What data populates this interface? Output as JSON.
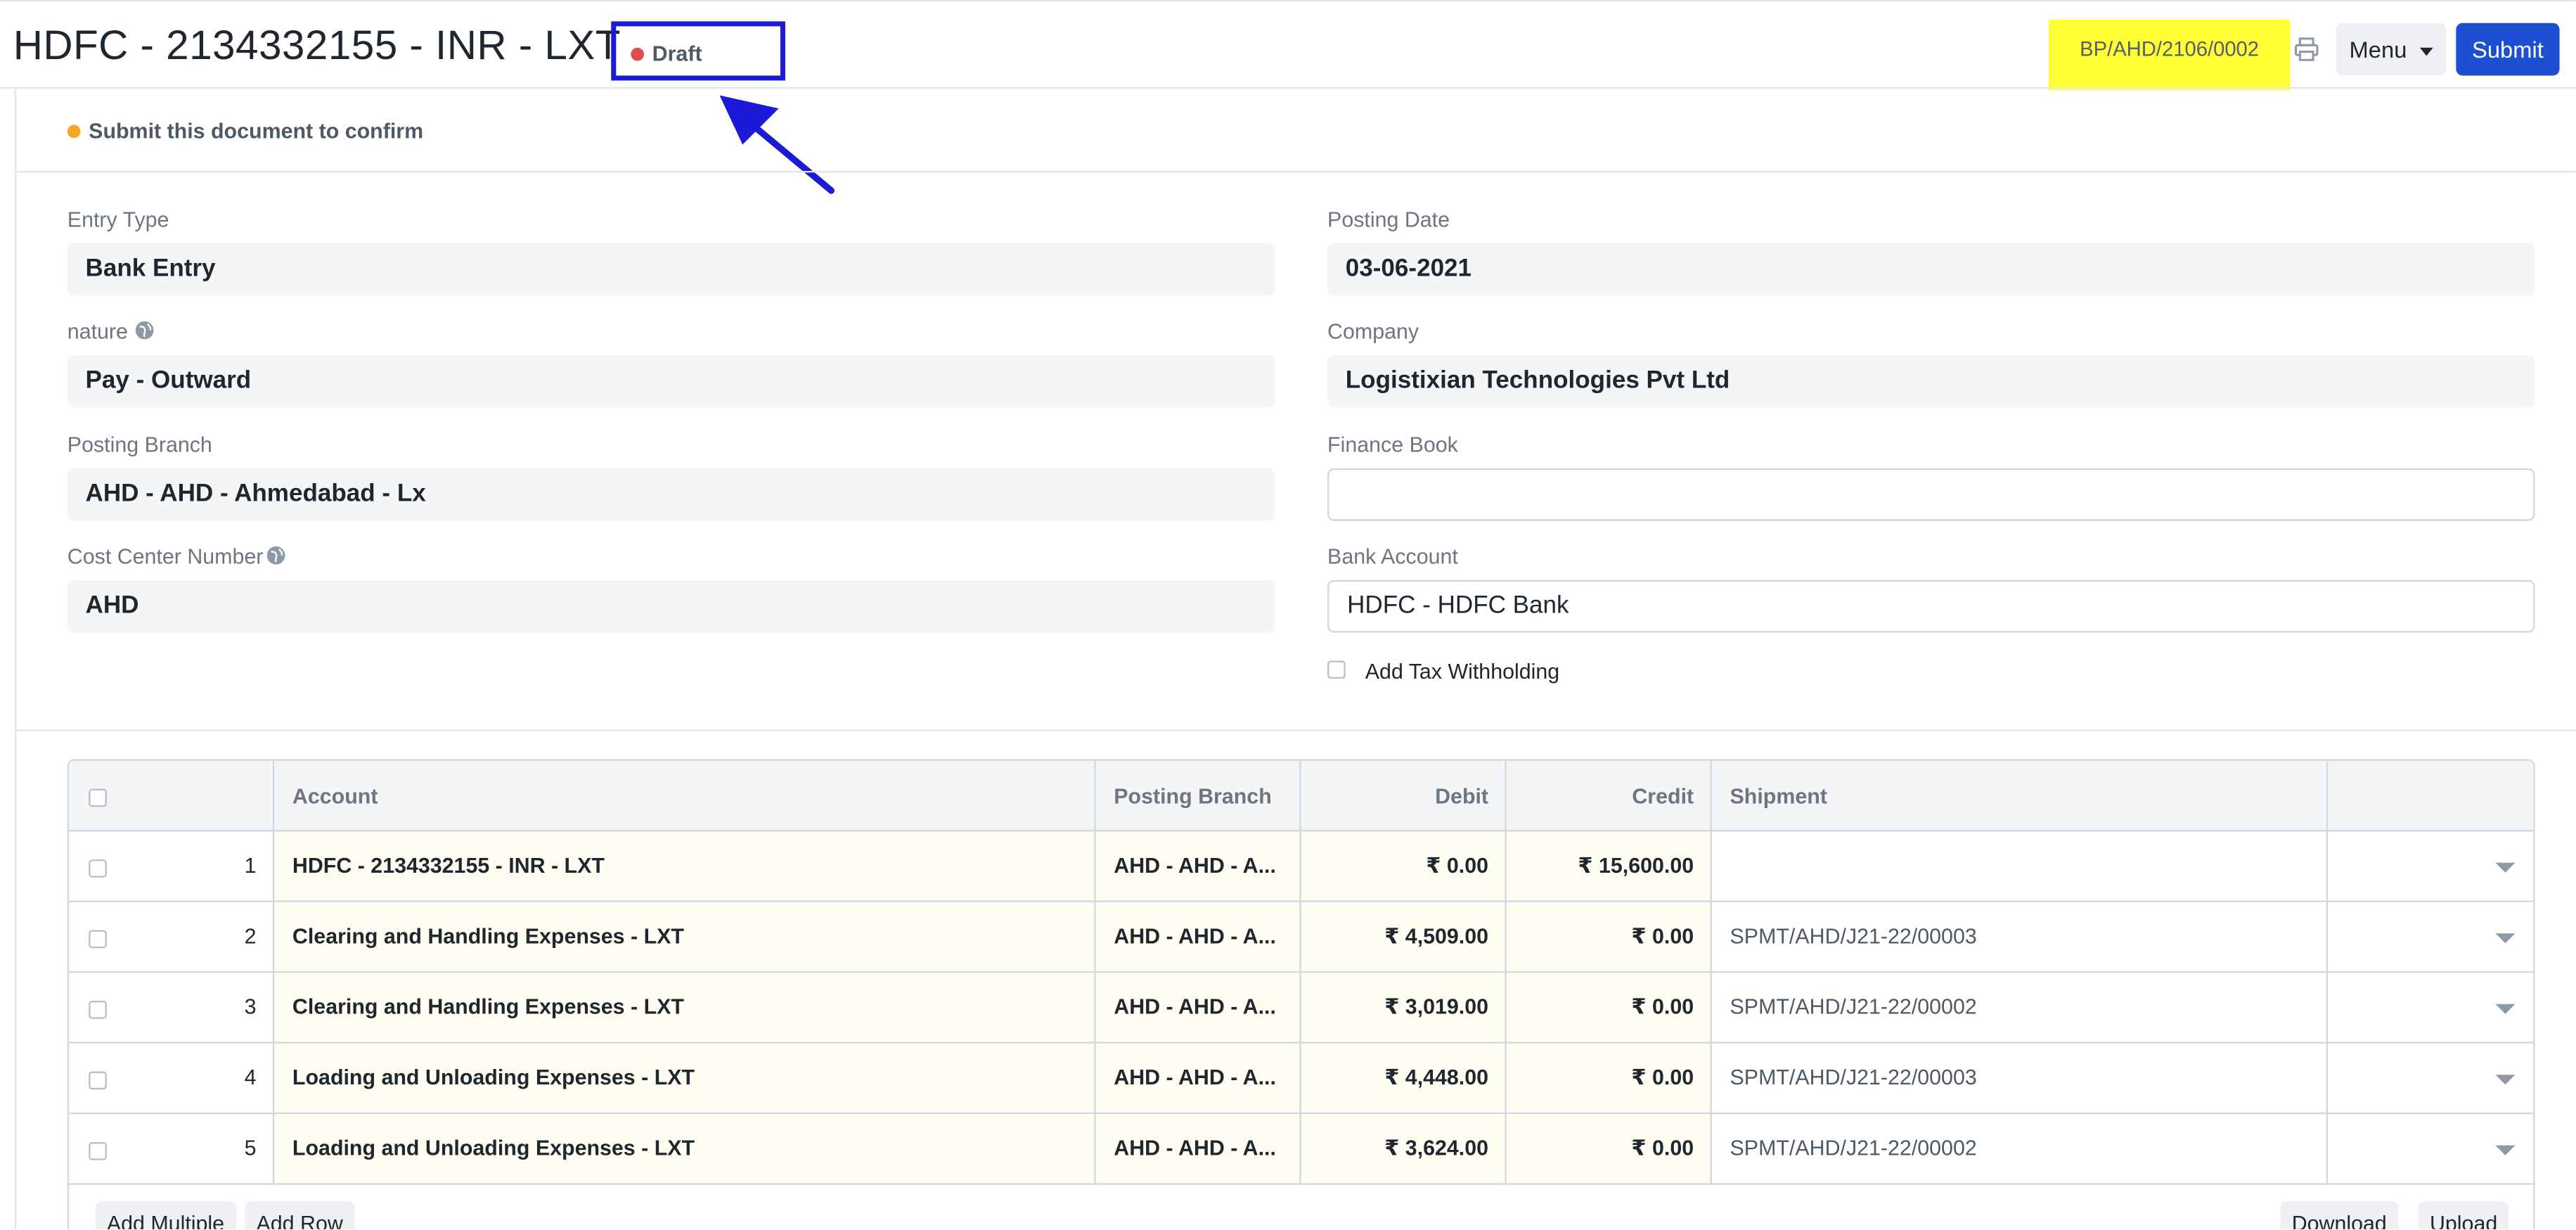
{
  "header": {
    "title": "HDFC - 2134332155 - INR - LXT",
    "status": "Draft",
    "doc_name": "BP/AHD/2106/0002",
    "menu_label": "Menu",
    "submit_label": "Submit"
  },
  "indicator": {
    "text": "Submit this document to confirm"
  },
  "form": {
    "entry_type": {
      "label": "Entry Type",
      "value": "Bank Entry"
    },
    "nature": {
      "label": "nature",
      "value": "Pay - Outward"
    },
    "posting_branch": {
      "label": "Posting Branch",
      "value": "AHD - AHD - Ahmedabad - Lx"
    },
    "cost_center": {
      "label": "Cost Center Number",
      "value": "AHD"
    },
    "posting_date": {
      "label": "Posting Date",
      "value": "03-06-2021"
    },
    "company": {
      "label": "Company",
      "value": "Logistixian Technologies Pvt Ltd"
    },
    "finance_book": {
      "label": "Finance Book",
      "value": ""
    },
    "bank_account": {
      "label": "Bank Account",
      "value": "HDFC - HDFC Bank"
    },
    "add_tax_withholding": {
      "label": "Add Tax Withholding",
      "checked": false
    }
  },
  "grid": {
    "columns": [
      "Account",
      "Posting Branch",
      "Debit",
      "Credit",
      "Shipment"
    ],
    "rows": [
      {
        "idx": "1",
        "account": "HDFC - 2134332155 - INR - LXT",
        "branch": "AHD - AHD - A...",
        "debit": "₹ 0.00",
        "credit": "₹ 15,600.00",
        "shipment": ""
      },
      {
        "idx": "2",
        "account": "Clearing and Handling Expenses - LXT",
        "branch": "AHD - AHD - A...",
        "debit": "₹ 4,509.00",
        "credit": "₹ 0.00",
        "shipment": "SPMT/AHD/J21-22/00003"
      },
      {
        "idx": "3",
        "account": "Clearing and Handling Expenses - LXT",
        "branch": "AHD - AHD - A...",
        "debit": "₹ 3,019.00",
        "credit": "₹ 0.00",
        "shipment": "SPMT/AHD/J21-22/00002"
      },
      {
        "idx": "4",
        "account": "Loading and Unloading Expenses - LXT",
        "branch": "AHD - AHD - A...",
        "debit": "₹ 4,448.00",
        "credit": "₹ 0.00",
        "shipment": "SPMT/AHD/J21-22/00003"
      },
      {
        "idx": "5",
        "account": "Loading and Unloading Expenses - LXT",
        "branch": "AHD - AHD - A...",
        "debit": "₹ 3,624.00",
        "credit": "₹ 0.00",
        "shipment": "SPMT/AHD/J21-22/00002"
      }
    ],
    "buttons": {
      "add_multiple": "Add Multiple",
      "add_row": "Add Row",
      "download": "Download",
      "upload": "Upload"
    }
  },
  "colors": {
    "primary": "#1c4fd1",
    "highlight": "#ffff33",
    "annotation": "#1c1ad6",
    "draft_dot": "#e24c4c",
    "indicator_dot": "#f5a623"
  },
  "icons": [
    "print-icon",
    "caret-down-icon",
    "globe-icon",
    "arrow-annotation-icon"
  ]
}
